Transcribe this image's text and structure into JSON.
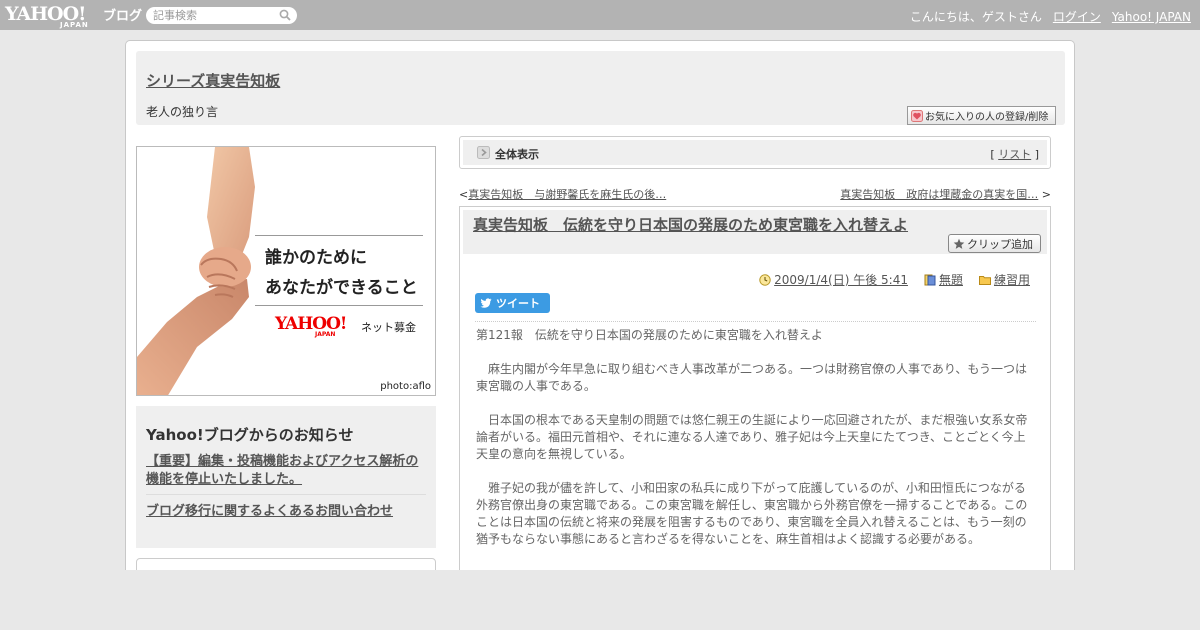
{
  "topbar": {
    "logo": "YAHOO!",
    "logo_sub": "JAPAN",
    "logo_blog": "ブログ",
    "search_placeholder": "記事検索",
    "greeting": "こんにちは、ゲストさん",
    "login": "ログイン",
    "yahoo_japan": "Yahoo! JAPAN"
  },
  "header": {
    "title": "シリーズ真実告知板",
    "description": "老人の独り言",
    "favorite_button": "お気に入りの人の登録/削除"
  },
  "ad": {
    "line1": "誰かのために",
    "line2": "あなたができること",
    "logo": "YAHOO!",
    "logo_sub": "JAPAN",
    "logo_text": "ネット募金",
    "credit": "photo:aflo"
  },
  "notice": {
    "title": "Yahoo!ブログからのお知らせ",
    "link1": "【重要】編集・投稿機能およびアクセス解析の機能を停止いたしました。",
    "link2": "ブログ移行に関するよくあるお問い合わせ"
  },
  "allview": {
    "label": "全体表示",
    "list_open": "[",
    "list_link": "リスト",
    "list_close": "]"
  },
  "nav": {
    "prev_arrow": "<",
    "prev": "真実告知板　与謝野馨氏を麻生氏の後…",
    "next": "真実告知板　政府は埋蔵金の真実を国…",
    "next_arrow": ">"
  },
  "entry": {
    "title": "真実告知板　伝統を守り日本国の発展のため東宮職を入れ替えよ",
    "clip_button": "クリップ追加",
    "date": "2009/1/4(日) 午後 5:41",
    "category": "無題",
    "folder": "練習用",
    "tweet": "ツイート",
    "paragraphs": [
      "第121報　伝統を守り日本国の発展のために東宮職を入れ替えよ",
      "　麻生内閣が今年早急に取り組むべき人事改革が二つある。一つは財務官僚の人事であり、もう一つは東宮職の人事である。",
      "　日本国の根本である天皇制の問題では悠仁親王の生誕により一応回避されたが、まだ根強い女系女帝論者がいる。福田元首相や、それに連なる人達であり、雅子妃は今上天皇にたてつき、ことごとく今上天皇の意向を無視している。",
      "　雅子妃の我が儘を許して、小和田家の私兵に成り下がって庇護しているのが、小和田恒氏につながる外務官僚出身の東宮職である。この東宮職を解任し、東宮職から外務官僚を一掃することである。このことは日本国の伝統と将来の発展を阻害するものであり、東宮職を全員入れ替えることは、もう一刻の猶予もならない事態にあると言わざるを得ないことを、麻生首相はよく認識する必要がある。"
    ]
  },
  "colors": {
    "topbar": "#b3b3b3",
    "tweet": "#3c9be3",
    "panel": "#efefef"
  }
}
